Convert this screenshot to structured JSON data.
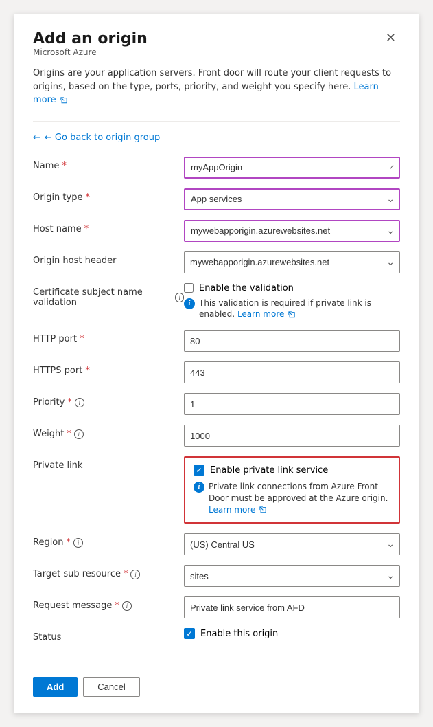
{
  "panel": {
    "title": "Add an origin",
    "subtitle": "Microsoft Azure",
    "description": "Origins are your application servers. Front door will route your client requests to origins, based on the type, ports, priority, and weight you specify here.",
    "learn_more_label": "Learn more",
    "back_label": "← Go back to origin group"
  },
  "form": {
    "name_label": "Name",
    "name_value": "myAppOrigin",
    "origin_type_label": "Origin type",
    "origin_type_value": "App services",
    "host_name_label": "Host name",
    "host_name_value": "mywebapporigin.azurewebsites.net",
    "origin_host_header_label": "Origin host header",
    "origin_host_header_value": "mywebapporigin.azurewebsites.net",
    "cert_label": "Certificate subject name validation",
    "cert_checkbox_label": "Enable the validation",
    "cert_info": "This validation is required if private link is enabled.",
    "cert_learn_more": "Learn more",
    "http_port_label": "HTTP port",
    "http_port_value": "80",
    "https_port_label": "HTTPS port",
    "https_port_value": "443",
    "priority_label": "Priority",
    "priority_value": "1",
    "weight_label": "Weight",
    "weight_value": "1000",
    "private_link_label": "Private link",
    "private_link_checkbox_label": "Enable private link service",
    "private_link_info": "Private link connections from Azure Front Door must be approved at the Azure origin.",
    "private_link_learn_more": "Learn more",
    "region_label": "Region",
    "region_value": "(US) Central US",
    "target_sub_resource_label": "Target sub resource",
    "target_sub_resource_value": "sites",
    "request_message_label": "Request message",
    "request_message_value": "Private link service from AFD",
    "status_label": "Status",
    "status_checkbox_label": "Enable this origin"
  },
  "footer": {
    "add_label": "Add",
    "cancel_label": "Cancel"
  },
  "icons": {
    "close": "✕",
    "chevron_down": "⌄",
    "external_link": "↗",
    "info": "i",
    "check": "✓",
    "back_arrow": "←"
  }
}
